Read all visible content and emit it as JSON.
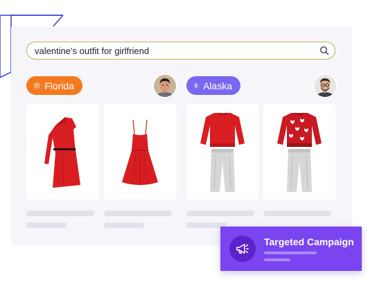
{
  "search": {
    "value": "valentine's outfit for girlfriend",
    "icon": "search-icon",
    "border_color": "#c2b25a"
  },
  "segments": [
    {
      "label": "Florida",
      "icon": "sun-icon",
      "color": "#f47a1f",
      "avatar": "male-avatar-dark-hair"
    },
    {
      "label": "Alaska",
      "icon": "snowflake-icon",
      "color": "#7a67f0",
      "avatar": "male-avatar-glasses"
    }
  ],
  "products": [
    {
      "name": "red one-shoulder dress",
      "icon": "dress-one-shoulder-icon"
    },
    {
      "name": "red sundress",
      "icon": "dress-strappy-icon"
    },
    {
      "name": "red sweater with grey pants",
      "icon": "sweater-pants-icon"
    },
    {
      "name": "heart sweater with grey pants",
      "icon": "heart-sweater-pants-icon"
    }
  ],
  "campaign": {
    "title": "Targeted Campaign",
    "icon": "megaphone-icon",
    "background": "#7a45f0"
  }
}
